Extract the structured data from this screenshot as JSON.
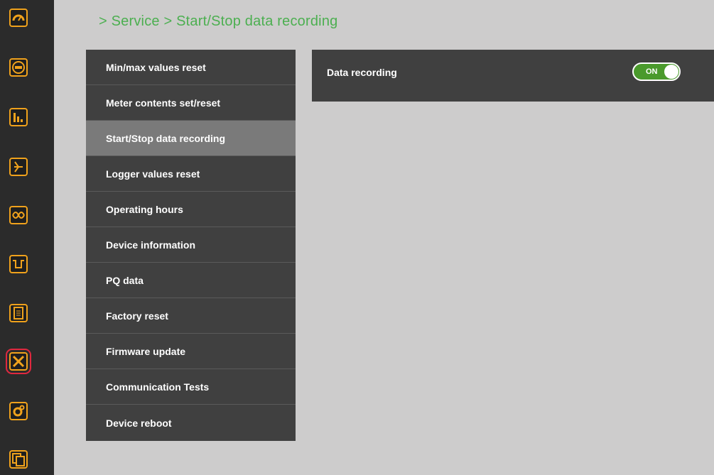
{
  "breadcrumb": "> Service > Start/Stop data recording",
  "rail": [
    {
      "icon": "speedometer-icon"
    },
    {
      "icon": "meter-icon"
    },
    {
      "icon": "bar-chart-icon"
    },
    {
      "icon": "phasor-icon"
    },
    {
      "icon": "waveform-icon"
    },
    {
      "icon": "pulse-icon"
    },
    {
      "icon": "document-icon"
    },
    {
      "icon": "tools-icon"
    },
    {
      "icon": "gears-icon"
    },
    {
      "icon": "copy-icon"
    }
  ],
  "menu": {
    "items": [
      {
        "label": "Min/max values reset"
      },
      {
        "label": "Meter contents set/reset"
      },
      {
        "label": "Start/Stop data recording"
      },
      {
        "label": "Logger values reset"
      },
      {
        "label": "Operating hours"
      },
      {
        "label": "Device information"
      },
      {
        "label": "PQ data"
      },
      {
        "label": "Factory reset"
      },
      {
        "label": "Firmware update"
      },
      {
        "label": "Communication Tests"
      },
      {
        "label": "Device reboot"
      }
    ]
  },
  "panel": {
    "label": "Data recording",
    "toggle_state": "ON"
  },
  "colors": {
    "accent": "#f0a21c",
    "breadcrumb": "#4caf50",
    "toggle_on": "#4a9a2c",
    "highlight": "#e0283f"
  }
}
